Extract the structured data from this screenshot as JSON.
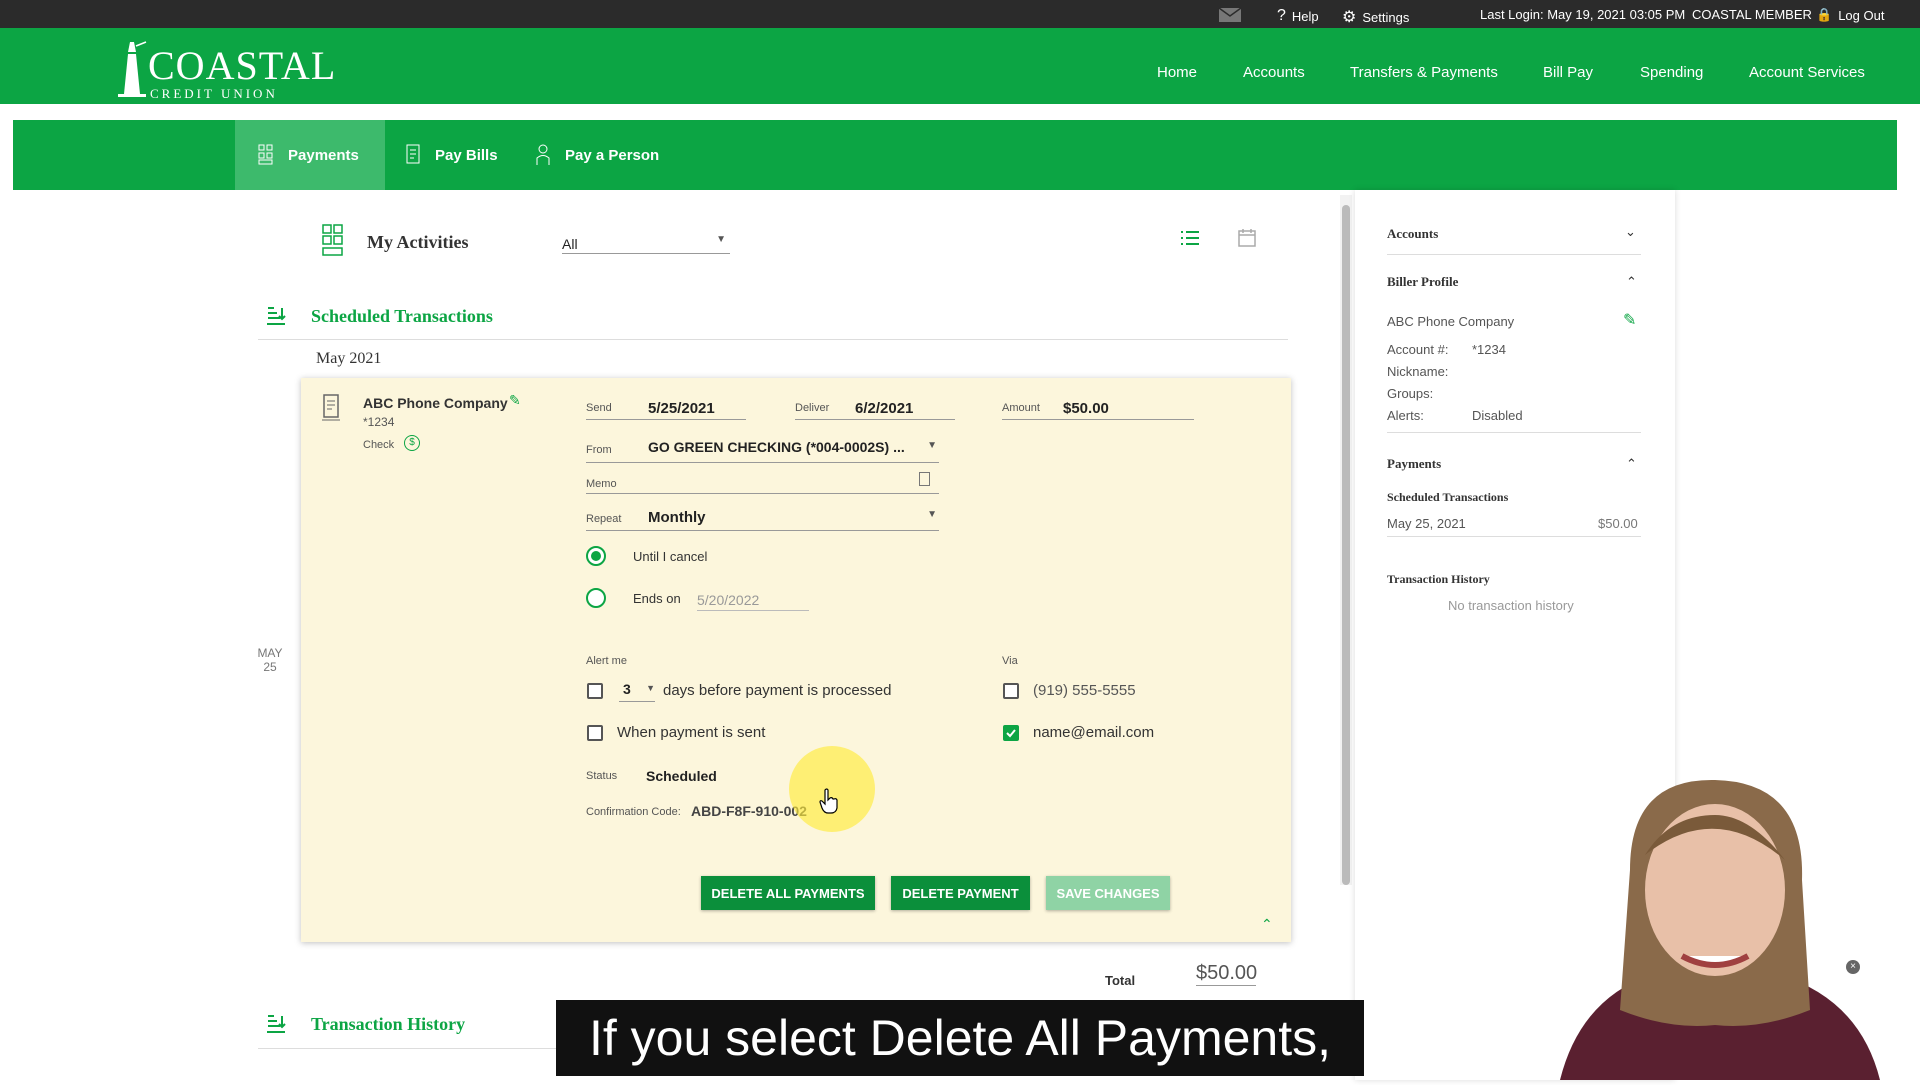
{
  "topbar": {
    "help": "Help",
    "settings": "Settings",
    "last_login": "Last Login: May 19, 2021 03:05 PM",
    "member": "COASTAL MEMBER",
    "logout": "Log Out"
  },
  "brand": {
    "name": "COASTAL",
    "sub": "CREDIT UNION"
  },
  "nav": [
    "Home",
    "Accounts",
    "Transfers & Payments",
    "Bill Pay",
    "Spending",
    "Account Services"
  ],
  "subnav": {
    "payments": "Payments",
    "pay_bills": "Pay Bills",
    "pay_person": "Pay a Person"
  },
  "activities": {
    "title": "My Activities",
    "filter": "All"
  },
  "scheduled": {
    "title": "Scheduled Transactions",
    "month": "May 2021",
    "date_month": "MAY",
    "date_day": "25"
  },
  "payment": {
    "biller": "ABC Phone Company",
    "account": "*1234",
    "method": "Check",
    "send_label": "Send",
    "send": "5/25/2021",
    "deliver_label": "Deliver",
    "deliver": "6/2/2021",
    "amount_label": "Amount",
    "amount": "$50.00",
    "from_label": "From",
    "from": "GO GREEN CHECKING (*004-0002S) ...",
    "memo_label": "Memo",
    "repeat_label": "Repeat",
    "repeat": "Monthly",
    "until_cancel": "Until I cancel",
    "ends_on": "Ends on",
    "ends_date": "5/20/2022",
    "alert_label": "Alert me",
    "days": "3",
    "days_text": "days before payment is processed",
    "when_sent": "When payment is sent",
    "via_label": "Via",
    "phone": "(919) 555-5555",
    "email": "name@email.com",
    "status_label": "Status",
    "status": "Scheduled",
    "conf_label": "Confirmation Code:",
    "conf": "ABD-F8F-910-002"
  },
  "buttons": {
    "delete_all": "DELETE ALL PAYMENTS",
    "delete": "DELETE PAYMENT",
    "save": "SAVE CHANGES"
  },
  "total": {
    "label": "Total",
    "value": "$50.00"
  },
  "history": {
    "title": "Transaction History"
  },
  "side": {
    "accounts": "Accounts",
    "biller_profile": "Biller Profile",
    "biller": "ABC Phone Company",
    "account_label": "Account #:",
    "account": "*1234",
    "nickname_label": "Nickname:",
    "groups_label": "Groups:",
    "alerts_label": "Alerts:",
    "alerts": "Disabled",
    "payments": "Payments",
    "scheduled": "Scheduled Transactions",
    "sched_date": "May 25, 2021",
    "sched_amount": "$50.00",
    "history": "Transaction History",
    "no_history": "No transaction history"
  },
  "caption": "If you select Delete All Payments,",
  "colors": {
    "brand_green": "#0ca544",
    "card_bg": "#fcf6dc",
    "topbar": "#2b2b2b"
  }
}
